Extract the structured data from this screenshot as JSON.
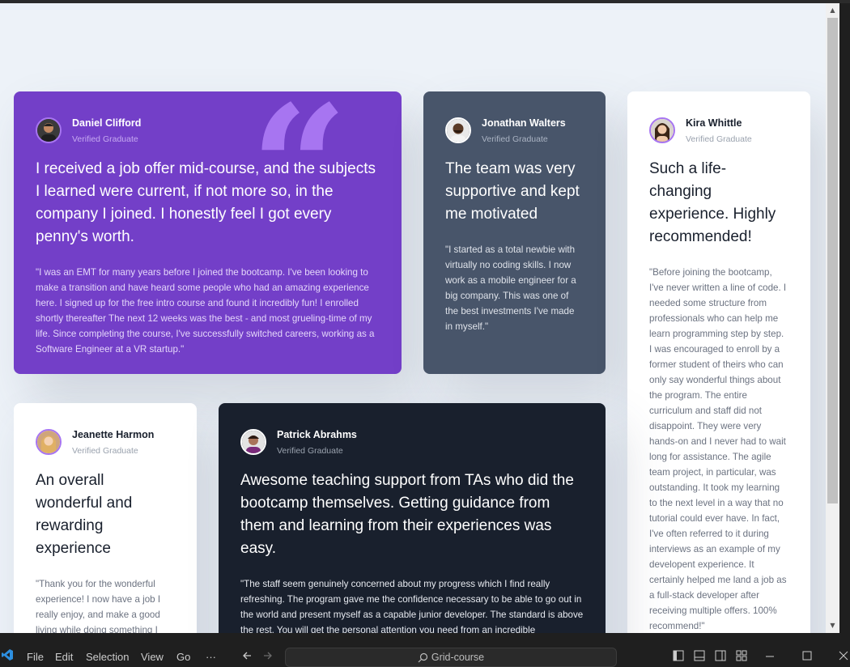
{
  "testimonials": [
    {
      "id": "daniel",
      "name": "Daniel Clifford",
      "role": "Verified Graduate",
      "headline": "I received a job offer mid-course, and the subjects I learned were current, if not more so, in the company I joined. I honestly feel I got every penny's worth.",
      "body": "\"I was an EMT for many years before I joined the bootcamp. I've been looking to make a transition and have heard some people who had an amazing experience here. I signed up for the free intro course and found it incredibly fun! I enrolled shortly thereafter The next 12 weeks was the best - and most grueling-time of my life. Since completing the course, I've successfully switched careers, working as a Software Engineer at a VR startup.\""
    },
    {
      "id": "jonathan",
      "name": "Jonathan Walters",
      "role": "Verified Graduate",
      "headline": "The team was very supportive and kept me motivated",
      "body": "\"I started as a total newbie with virtually no coding skills. I now work as a mobile engineer for a big company. This was one of the best investments I've made in myself.\""
    },
    {
      "id": "kira",
      "name": "Kira Whittle",
      "role": "Verified Graduate",
      "headline": "Such a life-changing experience. Highly recommended!",
      "body": "\"Before joining the bootcamp, I've never written a line of code. I needed some structure from professionals who can help me learn programming step by step. I was encouraged to enroll by a former student of theirs who can only say wonderful things about the program. The entire curriculum and staff did not disappoint. They were very hands-on and I never had to wait long for assistance. The agile team project, in particular, was outstanding. It took my learning to the next level in a way that no tutorial could ever have. In fact, I've often referred to it during interviews as an example of my developent experience. It certainly helped me land a job as a full-stack developer after receiving multiple offers. 100% recommend!\""
    },
    {
      "id": "jeanette",
      "name": "Jeanette Harmon",
      "role": "Verified Graduate",
      "headline": "An overall wonderful and rewarding experience",
      "body": "\"Thank you for the wonderful experience! I now have a job I really enjoy, and make a good living while doing something I love.\""
    },
    {
      "id": "patrick",
      "name": "Patrick Abrahms",
      "role": "Verified Graduate",
      "headline": "Awesome teaching support from TAs who did the bootcamp themselves. Getting guidance from them and learning from their experiences was easy.",
      "body": "\"The staff seem genuinely concerned about my progress which I find really refreshing. The program gave me the confidence necessary to be able to go out in the world and present myself as a capable junior developer. The standard is above the rest. You will get the personal attention you need from an incredible"
    }
  ],
  "colors": {
    "purple": "#733fc8",
    "slate": "#48556a",
    "dark": "#19202d",
    "white": "#ffffff",
    "page_bg": "#edf2f8",
    "quote_mark": "#a775f1"
  },
  "taskbar": {
    "menu": [
      "File",
      "Edit",
      "Selection",
      "View",
      "Go",
      "···"
    ],
    "search_text": "Grid-course"
  }
}
